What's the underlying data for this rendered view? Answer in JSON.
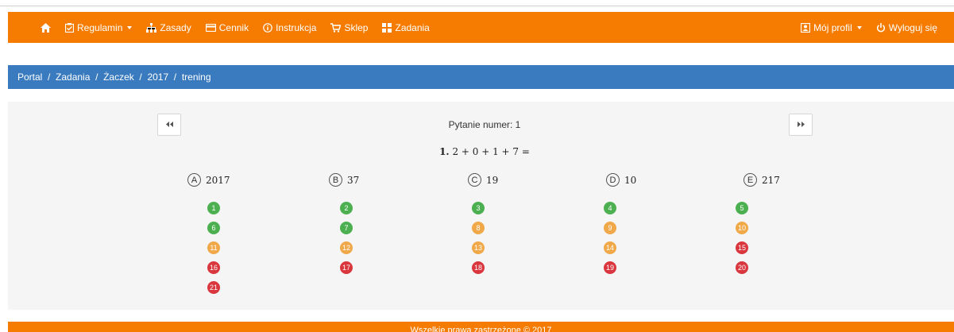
{
  "navbar": {
    "home_icon": "home-icon",
    "items": [
      {
        "label": "Regulamin",
        "icon": "clipboard-check-icon",
        "dropdown": true
      },
      {
        "label": "Zasady",
        "icon": "sitemap-icon"
      },
      {
        "label": "Cennik",
        "icon": "credit-card-icon"
      },
      {
        "label": "Instrukcja",
        "icon": "info-icon"
      },
      {
        "label": "Sklep",
        "icon": "cart-icon"
      },
      {
        "label": "Zadania",
        "icon": "grid-icon"
      }
    ],
    "profile_label": "Mój profil",
    "logout_label": "Wyloguj się"
  },
  "breadcrumb": [
    "Portal",
    "Zadania",
    "Żaczek",
    "2017",
    "trening"
  ],
  "question": {
    "label": "Pytanie numer: 1",
    "number": "1.",
    "text": "2 + 0 + 1 + 7 ="
  },
  "answers": [
    {
      "letter": "A",
      "value": "2017"
    },
    {
      "letter": "B",
      "value": "37"
    },
    {
      "letter": "C",
      "value": "19"
    },
    {
      "letter": "D",
      "value": "10"
    },
    {
      "letter": "E",
      "value": "217"
    }
  ],
  "question_numbers": [
    {
      "n": "1",
      "status": "green"
    },
    {
      "n": "2",
      "status": "green"
    },
    {
      "n": "3",
      "status": "green"
    },
    {
      "n": "4",
      "status": "green"
    },
    {
      "n": "5",
      "status": "green"
    },
    {
      "n": "6",
      "status": "green"
    },
    {
      "n": "7",
      "status": "green"
    },
    {
      "n": "8",
      "status": "orange"
    },
    {
      "n": "9",
      "status": "orange"
    },
    {
      "n": "10",
      "status": "orange"
    },
    {
      "n": "11",
      "status": "orange"
    },
    {
      "n": "12",
      "status": "orange"
    },
    {
      "n": "13",
      "status": "orange"
    },
    {
      "n": "14",
      "status": "orange"
    },
    {
      "n": "15",
      "status": "red"
    },
    {
      "n": "16",
      "status": "red"
    },
    {
      "n": "17",
      "status": "red"
    },
    {
      "n": "18",
      "status": "red"
    },
    {
      "n": "19",
      "status": "red"
    },
    {
      "n": "20",
      "status": "red"
    },
    {
      "n": "21",
      "status": "red"
    }
  ],
  "colors": {
    "brand": "#f57c00",
    "breadcrumb": "#3a7bbf",
    "green": "#4caf50",
    "orange": "#f0a848",
    "red": "#d9363e"
  },
  "footer": {
    "text": "Wszelkie prawa zastrzeżone © 2017"
  }
}
